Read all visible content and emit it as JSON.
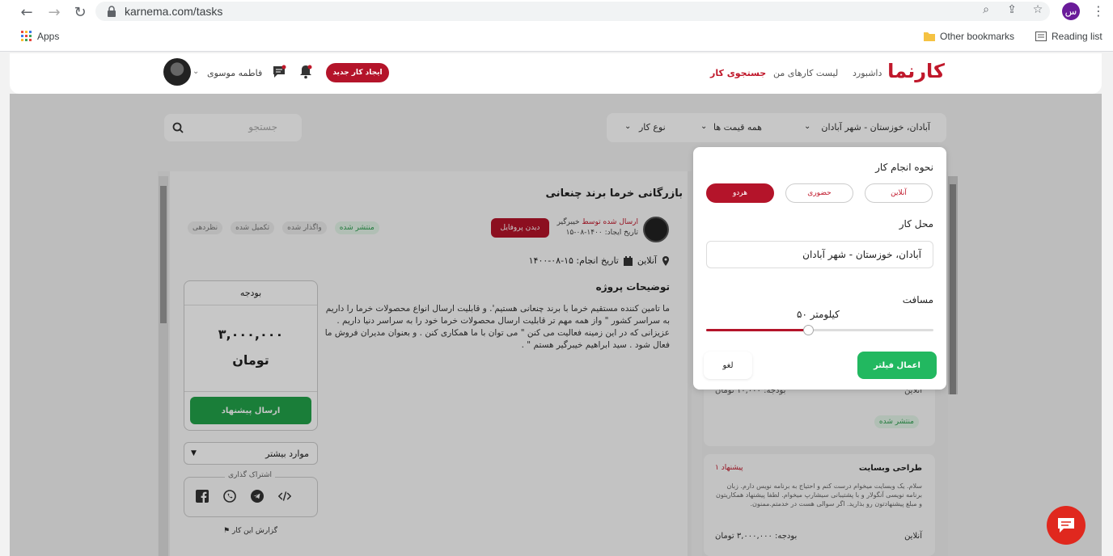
{
  "browser": {
    "url": "karnema.com/tasks",
    "profile_initial": "س",
    "bookmarks": {
      "apps": "Apps",
      "other": "Other bookmarks",
      "reading": "Reading list"
    }
  },
  "header": {
    "logo": "کارنما",
    "nav": {
      "dashboard": "داشبورد",
      "my_tasks": "لیست کارهای من",
      "search_tasks": "جستجوی کار"
    },
    "new_task": "ایجاد کار جدید",
    "user_name": "فاطمه موسوی"
  },
  "filters": {
    "location": "آبادان، خوزستان - شهر آبادان",
    "price": "همه قیمت ها",
    "type": "نوع کار",
    "search_placeholder": "جستجو"
  },
  "task": {
    "title": "بازرگانی خرما برند چنعانی",
    "badges": [
      "منتشر شده",
      "واگذار شده",
      "تکمیل شده",
      "نظردهی"
    ],
    "owner_prefix": "ارسال شده توسط",
    "owner_name": "خیبرگیر",
    "created": "تاریخ ایجاد: ۱۴۰۰-۰۸-۱۵",
    "profile_btn": "دیدن پروفایل",
    "mode": "آنلاین",
    "due": "تاریخ انجام: ۱۵-۰۸-۱۴۰۰",
    "desc_title": "توضیحات پروژه",
    "desc": "ما تامین کننده مستقیم خرما با برند چنعانی هستیم'. و قابلیت ارسال انواع محصولات خرما را داریم به سراسر کشور \" واز همه مهم تر قابلیت ارسال محصولات خرما خود را به سراسر دنیا داریم . عزیزانی که در این زمینه فعالیت می کنن \" می توان با ما همکاری کنن . و بعنوان مدیران فروش ما فعال شود . سید ابراهیم خیبرگیر هستم \" .",
    "budget_label": "بودجه",
    "budget_amount": "۳,۰۰۰,۰۰۰",
    "budget_currency": "تومان",
    "send_offer": "ارسال پیشنهاد",
    "more": "موارد بیشتر",
    "share": "اشتراک گذاری",
    "report": "گزارش این کار"
  },
  "list": {
    "card1": {
      "mode": "آنلاین",
      "budget": "بودجه:   ۱۰,۰۰۰  تومان",
      "status": "منتشر شده"
    },
    "card2": {
      "title": "طراحی وبسایت",
      "offers": "۱ پیشنهاد",
      "desc": "سلام. یک وبسایت میخوام درست کنم و احتیاج به برنامه نویس دارم. زبان برنامه نویسی آنگولار و با پشتیبانی سیشارپ میخوام. لطفا پیشنهاد همکاریتون و مبلغ پیشنهادتون رو بذارید. اگر سوالی هست در خدمتم.ممنون.",
      "budget": "بودجه:   ۳,۰۰۰,۰۰۰  تومان",
      "mode": "آنلاین"
    }
  },
  "popup": {
    "mode_title": "نحوه انجام کار",
    "modes": [
      "آنلاین",
      "حضوری",
      "هردو"
    ],
    "selected_mode": "هردو",
    "location_title": "محل کار",
    "location_value": "آبادان، خوزستان - شهر آبادان",
    "distance_title": "مسافت",
    "distance_value": "۵۰ کیلومتر",
    "distance_fraction": 0.45,
    "apply": "اعمال فیلتر",
    "cancel": "لغو"
  }
}
